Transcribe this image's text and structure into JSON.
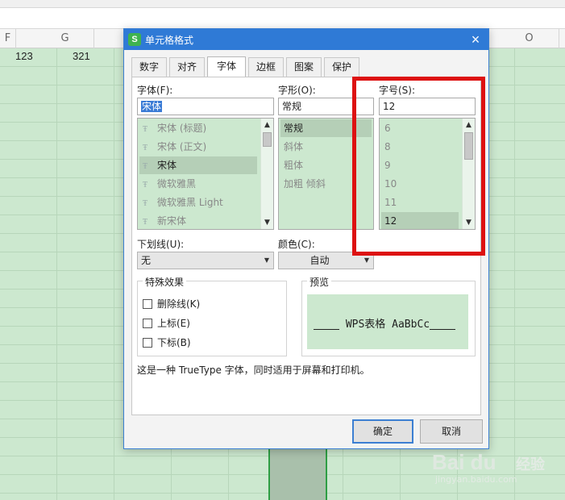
{
  "sheet": {
    "columns": [
      "F",
      "G",
      "O"
    ],
    "cells": [
      "123",
      "321"
    ]
  },
  "dialog": {
    "title": "单元格格式",
    "title_icon": "wps-s-logo",
    "close_glyph": "×",
    "tabs": [
      "数字",
      "对齐",
      "字体",
      "边框",
      "图案",
      "保护"
    ],
    "active_tab": "字体",
    "font": {
      "label": "字体(F):",
      "value": "宋体",
      "items": [
        "宋体 (标题)",
        "宋体 (正文)",
        "宋体",
        "微软雅黑",
        "微软雅黑 Light",
        "新宋体"
      ],
      "selected": "宋体"
    },
    "style": {
      "label": "字形(O):",
      "value": "常规",
      "items": [
        "常规",
        "斜体",
        "粗体",
        "加粗 倾斜"
      ],
      "selected": "常规"
    },
    "size": {
      "label": "字号(S):",
      "value": "12",
      "items": [
        "6",
        "8",
        "9",
        "10",
        "11",
        "12"
      ],
      "selected": "12"
    },
    "underline": {
      "label": "下划线(U):",
      "value": "无"
    },
    "color": {
      "label": "颜色(C):",
      "value": "自动"
    },
    "effects": {
      "title": "特殊效果",
      "items": [
        "删除线(K)",
        "上标(E)",
        "下标(B)"
      ]
    },
    "preview": {
      "title": "预览",
      "text": "WPS表格  AaBbCc"
    },
    "note": "这是一种 TrueType 字体，同时适用于屏幕和打印机。",
    "ok_label": "确定",
    "cancel_label": "取消"
  },
  "watermark": {
    "logo": "Bai du",
    "name": "经验",
    "url": "jingyan.baidu.com"
  },
  "colors": {
    "accent": "#2f7ad6",
    "highlight": "#dd1111",
    "list_bg": "#cce8cf"
  }
}
